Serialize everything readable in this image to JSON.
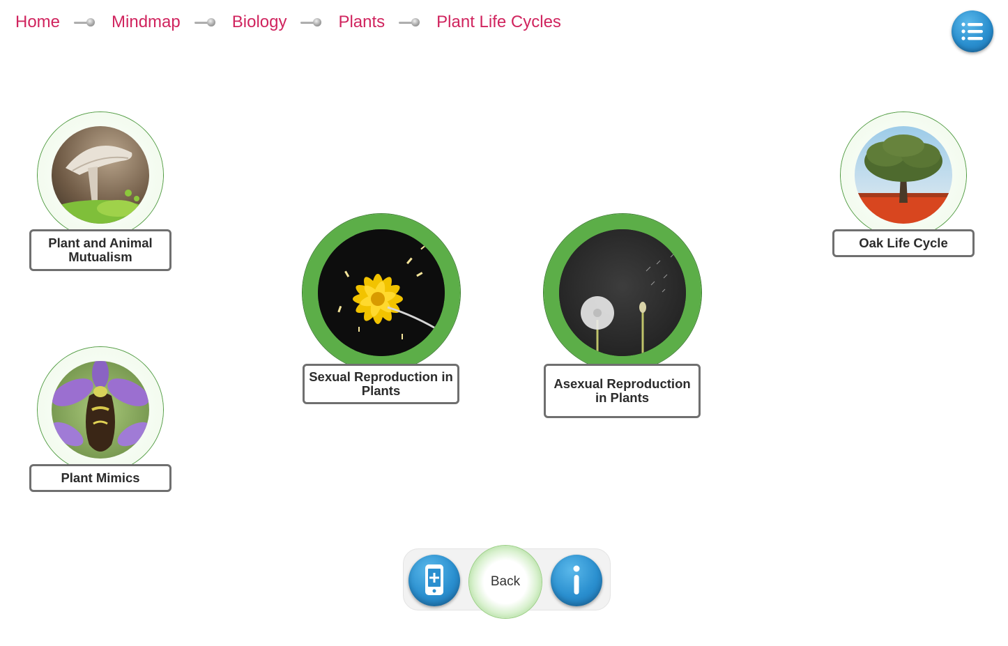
{
  "breadcrumb": {
    "items": [
      "Home",
      "Mindmap",
      "Biology",
      "Plants",
      "Plant Life Cycles"
    ]
  },
  "menu": {
    "icon": "list-icon"
  },
  "nodes": {
    "mutualism": {
      "label": "Plant and Animal Mutualism",
      "image": "mushroom-photo"
    },
    "mimics": {
      "label": "Plant Mimics",
      "image": "orchid-photo"
    },
    "sexual": {
      "label": "Sexual Reproduction in Plants",
      "image": "yellow-flower-pollen-photo"
    },
    "asexual": {
      "label": "Asexual Reproduction in Plants",
      "image": "dandelion-photo"
    },
    "oak": {
      "label": "Oak Life Cycle",
      "image": "oak-tree-photo"
    }
  },
  "toolbar": {
    "back_label": "Back",
    "left_icon": "mobile-add-icon",
    "right_icon": "info-icon"
  },
  "colors": {
    "breadcrumb": "#d0245e",
    "ring_green": "#5cae48",
    "button_blue": "#2a8fcf",
    "label_border": "#6f6f6f"
  }
}
